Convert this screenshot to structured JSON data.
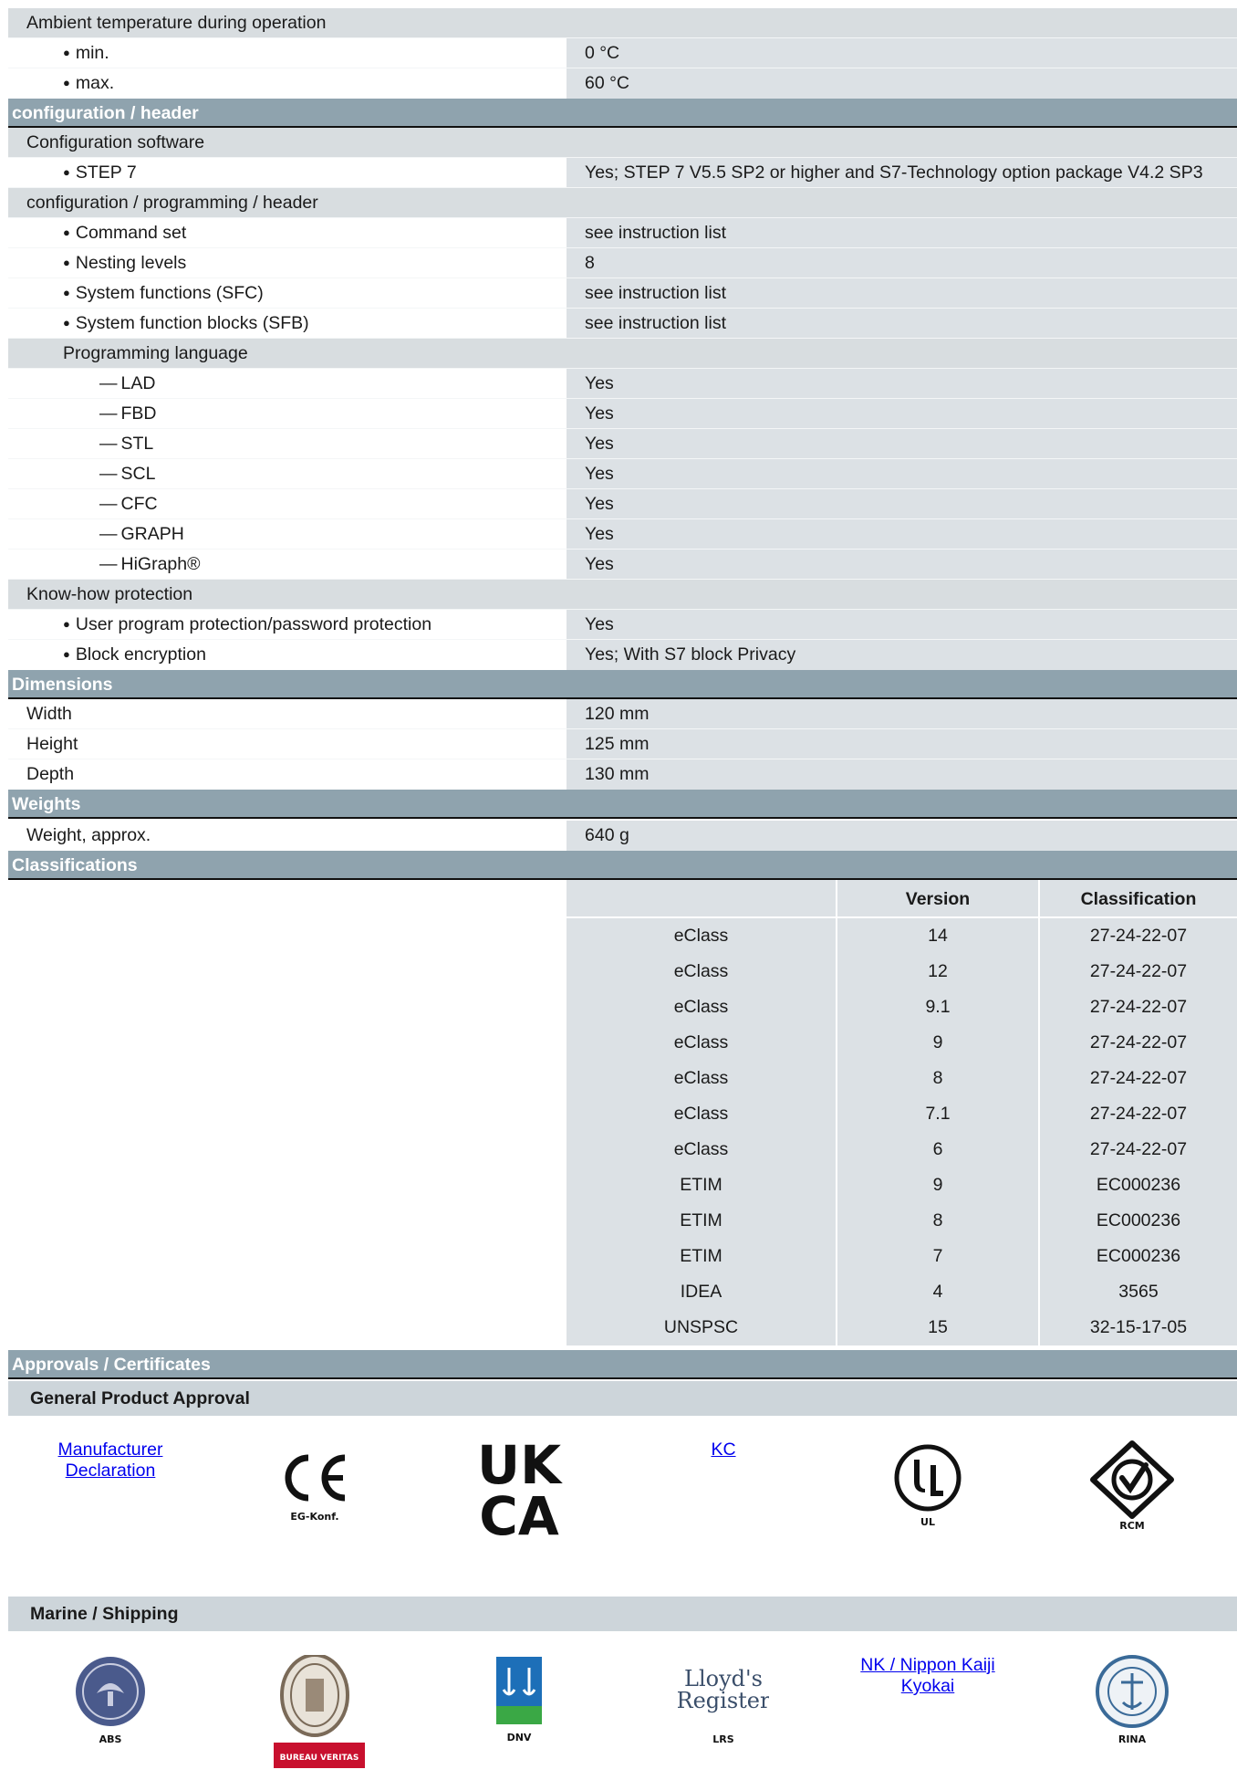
{
  "ambient": {
    "title": "Ambient temperature during operation",
    "rows": [
      {
        "k": "min.",
        "v": "0 °C"
      },
      {
        "k": "max.",
        "v": "60 °C"
      }
    ]
  },
  "config_header": "configuration / header",
  "config_software": {
    "title": "Configuration software",
    "rows": [
      {
        "k": "STEP 7",
        "v": "Yes; STEP 7 V5.5 SP2 or higher and S7-Technology option package V4.2 SP3"
      }
    ]
  },
  "config_prog": {
    "title": "configuration / programming / header",
    "rows": [
      {
        "k": "Command set",
        "v": "see instruction list"
      },
      {
        "k": "Nesting levels",
        "v": "8"
      },
      {
        "k": "System functions (SFC)",
        "v": "see instruction list"
      },
      {
        "k": "System function blocks (SFB)",
        "v": "see instruction list"
      }
    ]
  },
  "prog_lang": {
    "title": "Programming language",
    "rows": [
      {
        "k": "LAD",
        "v": "Yes"
      },
      {
        "k": "FBD",
        "v": "Yes"
      },
      {
        "k": "STL",
        "v": "Yes"
      },
      {
        "k": "SCL",
        "v": "Yes"
      },
      {
        "k": "CFC",
        "v": "Yes"
      },
      {
        "k": "GRAPH",
        "v": "Yes"
      },
      {
        "k": "HiGraph®",
        "v": "Yes"
      }
    ]
  },
  "knowhow": {
    "title": "Know-how protection",
    "rows": [
      {
        "k": "User program protection/password protection",
        "v": "Yes"
      },
      {
        "k": "Block encryption",
        "v": "Yes; With S7 block Privacy"
      }
    ]
  },
  "dimensions": {
    "title": "Dimensions",
    "rows": [
      {
        "k": "Width",
        "v": "120 mm"
      },
      {
        "k": "Height",
        "v": "125 mm"
      },
      {
        "k": "Depth",
        "v": "130 mm"
      }
    ]
  },
  "weights": {
    "title": "Weights",
    "rows": [
      {
        "k": "Weight, approx.",
        "v": "640 g"
      }
    ]
  },
  "classifications": {
    "title": "Classifications",
    "headers": [
      "",
      "Version",
      "Classification"
    ],
    "rows": [
      [
        "eClass",
        "14",
        "27-24-22-07"
      ],
      [
        "eClass",
        "12",
        "27-24-22-07"
      ],
      [
        "eClass",
        "9.1",
        "27-24-22-07"
      ],
      [
        "eClass",
        "9",
        "27-24-22-07"
      ],
      [
        "eClass",
        "8",
        "27-24-22-07"
      ],
      [
        "eClass",
        "7.1",
        "27-24-22-07"
      ],
      [
        "eClass",
        "6",
        "27-24-22-07"
      ],
      [
        "ETIM",
        "9",
        "EC000236"
      ],
      [
        "ETIM",
        "8",
        "EC000236"
      ],
      [
        "ETIM",
        "7",
        "EC000236"
      ],
      [
        "IDEA",
        "4",
        "3565"
      ],
      [
        "UNSPSC",
        "15",
        "32-15-17-05"
      ]
    ]
  },
  "approvals": {
    "title": "Approvals / Certificates",
    "general": {
      "title": "General Product Approval",
      "manufacturer_link": "Manufacturer Declaration",
      "ce_label": "EG-Konf.",
      "ukca": [
        "UK",
        "CA"
      ],
      "kc_link": "KC",
      "ul_label": "UL",
      "rcm_label": "RCM"
    },
    "marine": {
      "title": "Marine / Shipping",
      "abs_label": "ABS",
      "bv_label": "BUREAU VERITAS",
      "dnv_label": "DNV",
      "lrs_label": "LRS",
      "lloyds_text": [
        "Lloyd's",
        "Register"
      ],
      "nk_link": "NK / Nippon Kaiji Kyokai",
      "rina_label": "RINA"
    }
  },
  "colors": {
    "section_header": "#8fa3ae",
    "sub_header": "#d8dde0",
    "value_cell": "#dce1e5",
    "link": "#0000ee"
  }
}
